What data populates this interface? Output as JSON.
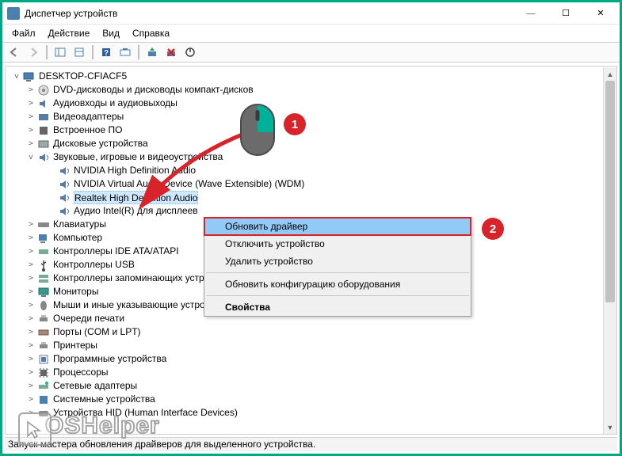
{
  "window": {
    "title": "Диспетчер устройств",
    "controls": {
      "min": "—",
      "max": "☐",
      "close": "✕"
    }
  },
  "menubar": [
    "Файл",
    "Действие",
    "Вид",
    "Справка"
  ],
  "tree": {
    "root": "DESKTOP-CFIACF5",
    "items": [
      {
        "label": "DVD-дисководы и дисководы компакт-дисков",
        "exp": ">"
      },
      {
        "label": "Аудиовходы и аудиовыходы",
        "exp": ">"
      },
      {
        "label": "Видеоадаптеры",
        "exp": ">"
      },
      {
        "label": "Встроенное ПО",
        "exp": ">"
      },
      {
        "label": "Дисковые устройства",
        "exp": ">"
      },
      {
        "label": "Звуковые, игровые и видеоустройства",
        "exp": "v",
        "children": [
          "NVIDIA High Definition Audio",
          "NVIDIA Virtual Audio Device (Wave Extensible) (WDM)",
          "Realtek High Definition Audio",
          "Аудио Intel(R) для дисплеев"
        ],
        "selected_index": 2
      },
      {
        "label": "Клавиатуры",
        "exp": ">"
      },
      {
        "label": "Компьютер",
        "exp": ">"
      },
      {
        "label": "Контроллеры IDE ATA/ATAPI",
        "exp": ">"
      },
      {
        "label": "Контроллеры USB",
        "exp": ">"
      },
      {
        "label": "Контроллеры запоминающих устройств",
        "exp": ">"
      },
      {
        "label": "Мониторы",
        "exp": ">"
      },
      {
        "label": "Мыши и иные указывающие устройства",
        "exp": ">"
      },
      {
        "label": "Очереди печати",
        "exp": ">"
      },
      {
        "label": "Порты (COM и LPT)",
        "exp": ">"
      },
      {
        "label": "Принтеры",
        "exp": ">"
      },
      {
        "label": "Программные устройства",
        "exp": ">"
      },
      {
        "label": "Процессоры",
        "exp": ">"
      },
      {
        "label": "Сетевые адаптеры",
        "exp": ">"
      },
      {
        "label": "Системные устройства",
        "exp": ">"
      },
      {
        "label": "Устройства HID (Human Interface Devices)",
        "exp": ">"
      }
    ]
  },
  "context_menu": {
    "items": [
      "Обновить драйвер",
      "Отключить устройство",
      "Удалить устройство",
      "Обновить конфигурацию оборудования",
      "Свойства"
    ],
    "highlighted_index": 0,
    "separators_after": [
      2,
      3
    ]
  },
  "annotations": {
    "badge1": "1",
    "badge2": "2"
  },
  "statusbar": "Запуск мастера обновления драйверов для выделенного устройства.",
  "watermark": "OSHelper"
}
